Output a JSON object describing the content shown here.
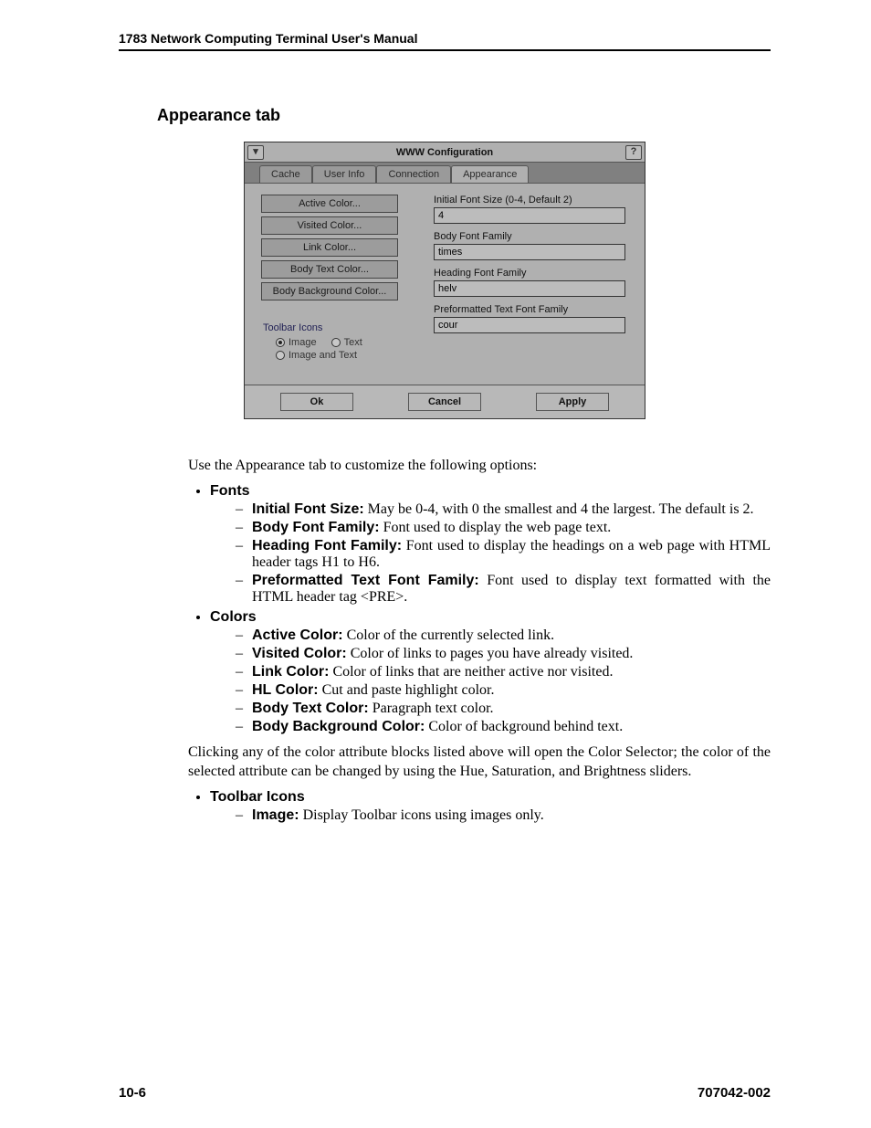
{
  "header": {
    "running": "1783 Network Computing Terminal User's Manual"
  },
  "section": {
    "heading": "Appearance tab"
  },
  "window": {
    "title": "WWW Configuration",
    "menu_glyph": "▾",
    "help_glyph": "?",
    "tabs": {
      "cache": "Cache",
      "userinfo": "User Info",
      "connection": "Connection",
      "appearance": "Appearance"
    },
    "buttons": {
      "active_color": "Active Color...",
      "visited_color": "Visited Color...",
      "link_color": "Link Color...",
      "body_text_color": "Body Text Color...",
      "body_bg_color": "Body Background Color..."
    },
    "group": {
      "toolbar_icons": "Toolbar Icons",
      "opt_image": "Image",
      "opt_text": "Text",
      "opt_image_and_text": "Image and Text"
    },
    "fields": {
      "initial_font_size_label": "Initial Font Size (0-4, Default 2)",
      "initial_font_size_value": "4",
      "body_font_family_label": "Body Font Family",
      "body_font_family_value": "times",
      "heading_font_family_label": "Heading Font Family",
      "heading_font_family_value": "helv",
      "pre_font_family_label": "Preformatted Text Font Family",
      "pre_font_family_value": "cour"
    },
    "footer": {
      "ok": "Ok",
      "cancel": "Cancel",
      "apply": "Apply"
    }
  },
  "para": {
    "intro": "Use the Appearance tab to customize the following options:",
    "color_click": "Clicking any of the color attribute blocks listed above will open the Color Selector; the color of the selected attribute can be changed by using the Hue, Saturation, and Brightness sliders."
  },
  "list": {
    "fonts": "Fonts",
    "fonts_items": {
      "initial_t": "Initial Font Size:",
      "initial_d": " May be 0-4, with 0 the smallest and 4 the largest. The default is 2.",
      "body_t": "Body Font Family:",
      "body_d": " Font used to display the web page text.",
      "heading_t": "Heading Font Family:",
      "heading_d": " Font used to display the headings on a web page with HTML header tags H1 to H6.",
      "pre_t": "Preformatted Text Font Family:",
      "pre_d": " Font used to display text formatted with the HTML header tag <PRE>."
    },
    "colors": "Colors",
    "colors_items": {
      "active_t": "Active Color:",
      "active_d": " Color of the currently selected link.",
      "visited_t": "Visited Color:",
      "visited_d": " Color of links to pages you have already visited.",
      "link_t": "Link Color:",
      "link_d": " Color of links that are neither active nor visited.",
      "hl_t": "HL Color:",
      "hl_d": " Cut and paste highlight color.",
      "bodytext_t": "Body Text Color:",
      "bodytext_d": " Paragraph text color.",
      "bodybg_t": "Body Background Color:",
      "bodybg_d": " Color of background behind text."
    },
    "toolbar": "Toolbar Icons",
    "toolbar_items": {
      "image_t": "Image:",
      "image_d": " Display Toolbar icons using images only."
    }
  },
  "footer": {
    "page": "10-6",
    "docnum": "707042-002"
  }
}
